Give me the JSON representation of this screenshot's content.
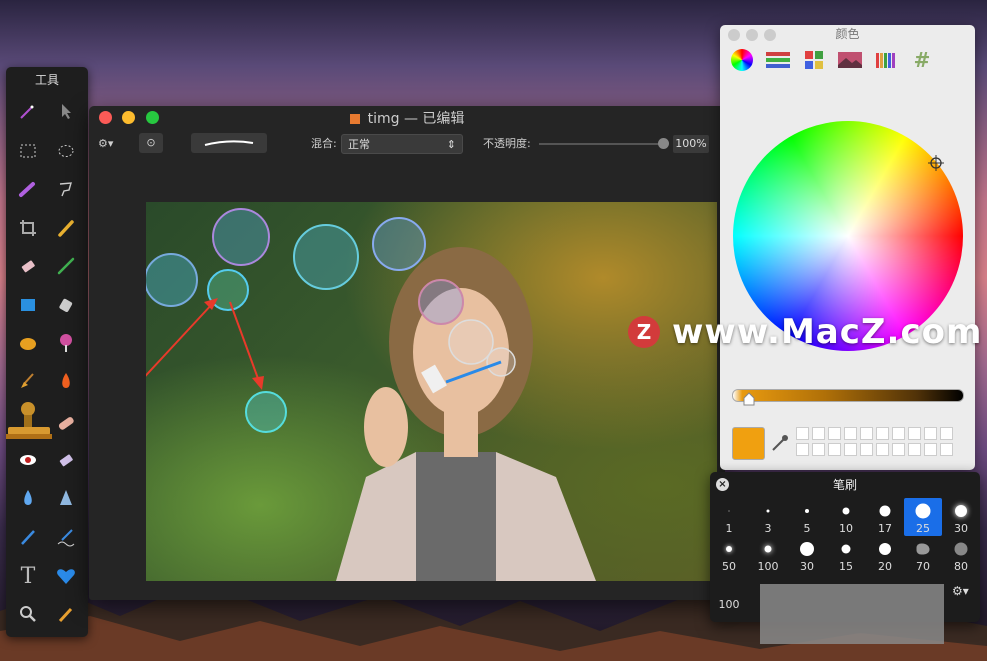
{
  "tools_panel": {
    "title": "工具"
  },
  "editor": {
    "title": "timg — 已编辑",
    "toolbar": {
      "blend_label": "混合:",
      "blend_value": "正常",
      "opacity_label": "不透明度:",
      "opacity_value": "100%"
    }
  },
  "colors_panel": {
    "title": "颜色",
    "current_color": "#F0A010"
  },
  "brushes_panel": {
    "title": "笔刷",
    "sizes": [
      "1",
      "3",
      "5",
      "10",
      "17",
      "25",
      "30",
      "50",
      "100",
      "30",
      "15",
      "20",
      "70",
      "80",
      "100"
    ],
    "selected": "25"
  },
  "watermark": {
    "logo": "Z",
    "text": "www.MacZ.com"
  }
}
